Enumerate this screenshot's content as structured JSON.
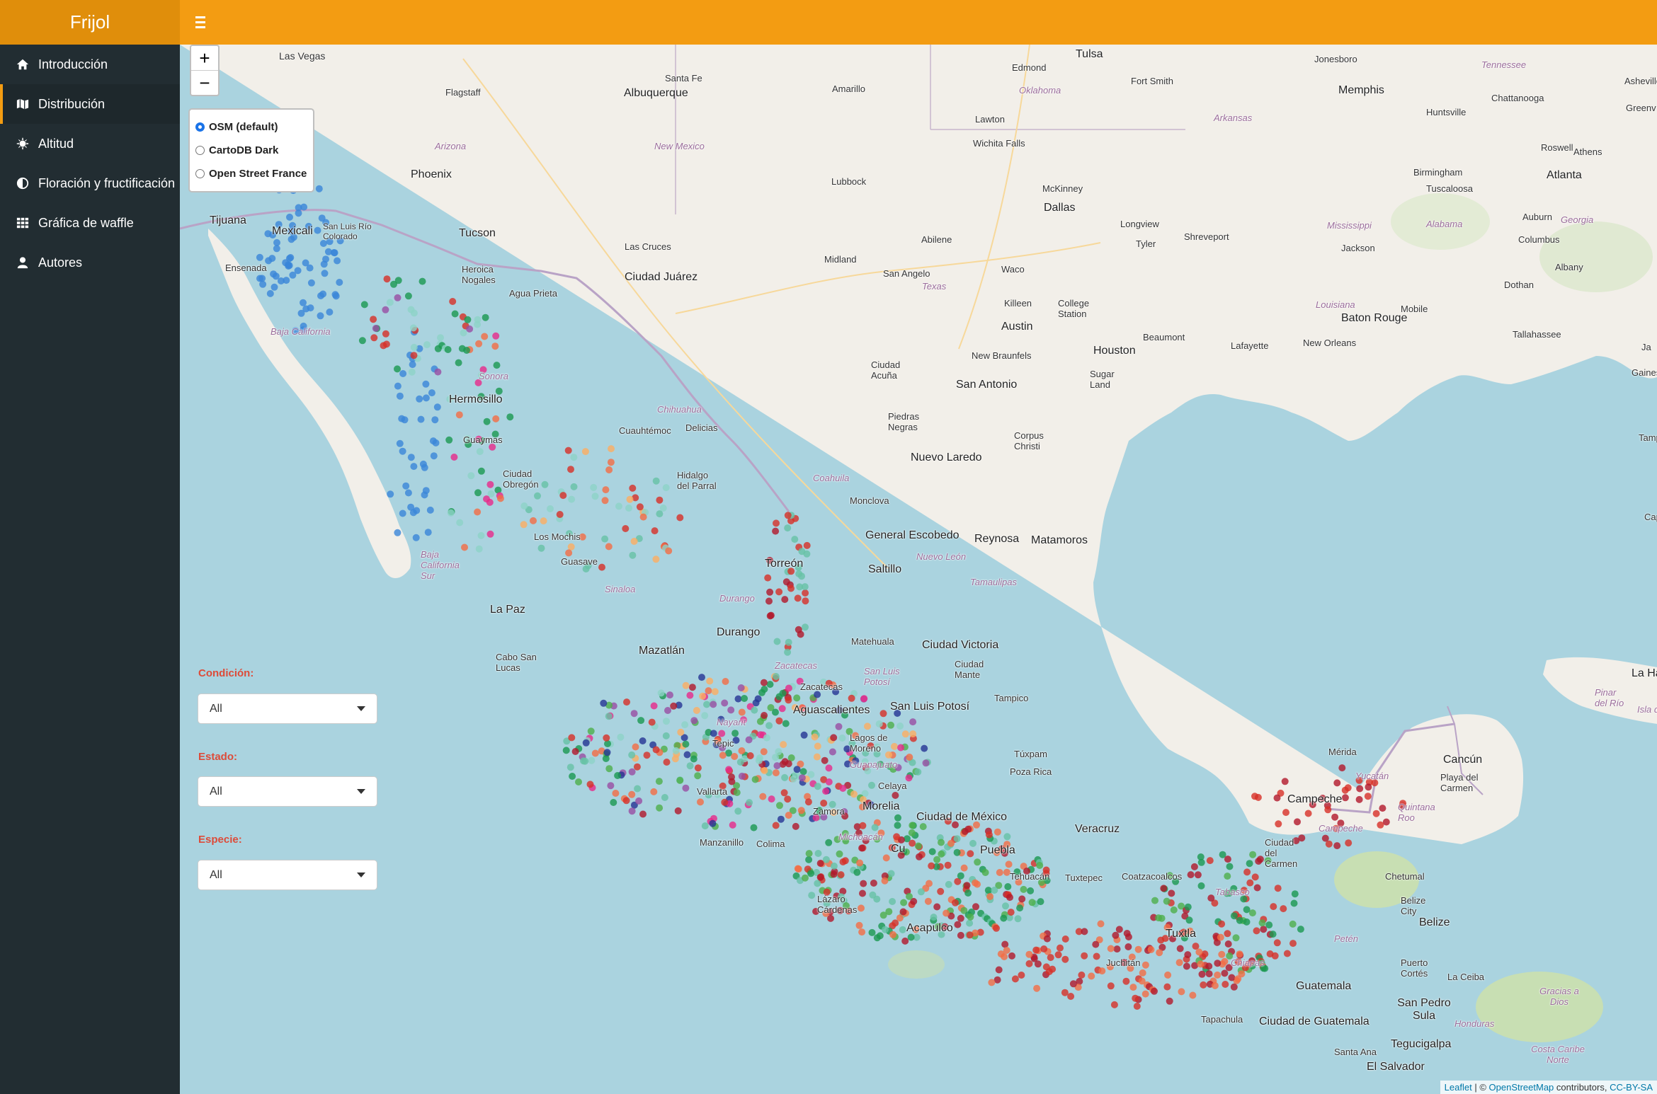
{
  "app": {
    "title": "Frijol"
  },
  "sidebar": {
    "items": [
      {
        "label": "Introducción",
        "icon": "home-icon",
        "active": false
      },
      {
        "label": "Distribución",
        "icon": "map-icon",
        "active": true
      },
      {
        "label": "Altitud",
        "icon": "sun-icon",
        "active": false
      },
      {
        "label": "Floración y fructificación",
        "icon": "adjust-icon",
        "active": false
      },
      {
        "label": "Gráfica de waffle",
        "icon": "grid-icon",
        "active": false
      },
      {
        "label": "Autores",
        "icon": "user-icon",
        "active": false
      }
    ]
  },
  "map": {
    "zoom_in": "+",
    "zoom_out": "−",
    "layers": [
      {
        "label": "OSM (default)",
        "selected": true
      },
      {
        "label": "CartoDB Dark",
        "selected": false
      },
      {
        "label": "Open Street France",
        "selected": false
      }
    ],
    "filters": [
      {
        "label": "Condición:",
        "value": "All"
      },
      {
        "label": "Estado:",
        "value": "All"
      },
      {
        "label": "Especie:",
        "value": "All"
      }
    ],
    "attribution": {
      "leaflet": "Leaflet",
      "sep": " | © ",
      "osm": "OpenStreetMap",
      "contrib": " contributors, ",
      "license": "CC-BY-SA"
    },
    "places": {
      "las_vegas": "Las Vegas",
      "flagstaff": "Flagstaff",
      "albuquerque": "Albuquerque",
      "santa_fe": "Santa Fe",
      "amarillo": "Amarillo",
      "edmond": "Edmond",
      "oklahoma": "Oklahoma",
      "tulsa": "Tulsa",
      "fort_smith": "Fort Smith",
      "memphis": "Memphis",
      "jonesboro": "Jonesboro",
      "tennessee": "Tennessee",
      "chattanooga": "Chattanooga",
      "huntsville": "Huntsville",
      "roswell": "Roswell",
      "athens": "Athens",
      "atlanta": "Atlanta",
      "birmingham": "Birmingham",
      "arkansas": "Arkansas",
      "arizona": "Arizona",
      "new_mexico": "New Mexico",
      "phoenix": "Phoenix",
      "lawton": "Lawton",
      "wichita_falls": "Wichita Falls",
      "lubbock": "Lubbock",
      "mckinney": "McKinney",
      "dallas": "Dallas",
      "tuscaloosa": "Tuscaloosa",
      "mississippi": "Mississippi",
      "alabama": "Alabama",
      "georgia": "Georgia",
      "auburn": "Auburn",
      "columbus": "Columbus",
      "tijuana": "Tijuana",
      "mexicali": "Mexicali",
      "san_luis_rc": "San Luis Río Colorado",
      "tucson": "Tucson",
      "las_cruces": "Las Cruces",
      "abilene": "Abilene",
      "longview": "Longview",
      "tyler": "Tyler",
      "shreveport": "Shreveport",
      "jackson": "Jackson",
      "albany": "Albany",
      "dothan": "Dothan",
      "ensenada": "Ensenada",
      "heroica_nogales": "Heroica Nogales",
      "ciudad_juarez": "Ciudad Juárez",
      "midland": "Midland",
      "san_angelo": "San Angelo",
      "texas": "Texas",
      "waco": "Waco",
      "agua_prieta": "Agua Prieta",
      "killeen": "Killeen",
      "college_station": "College Station",
      "baton_rouge": "Baton Rouge",
      "mobile": "Mobile",
      "tallahassee": "Tallahassee",
      "baja_california": "Baja California",
      "austin": "Austin",
      "beaumont": "Beaumont",
      "lafayette": "Lafayette",
      "new_orleans": "New Orleans",
      "louisiana": "Louisiana",
      "houston": "Houston",
      "sugar_land": "Sugar Land",
      "new_braunfels": "New Braunfels",
      "sonora": "Sonora",
      "hermosillo": "Hermosillo",
      "ciudad_acuna": "Ciudad Acuña",
      "san_antonio": "San Antonio",
      "chihuahua": "Chihuahua",
      "delicias": "Delicias",
      "cuauhtemoc": "Cuauhtémoc",
      "guaymas": "Guaymas",
      "piedras_negras": "Piedras Negras",
      "corpus_christi": "Corpus Christi",
      "nuevo_laredo": "Nuevo Laredo",
      "ciudad_obregon": "Ciudad Obregón",
      "hidalgo_parral": "Hidalgo del Parral",
      "coahuila": "Coahuila",
      "monclova": "Monclova",
      "general_escobedo": "General Escobedo",
      "reynosa": "Reynosa",
      "matamoros": "Matamoros",
      "los_mochis": "Los Mochis",
      "nuevo_leon": "Nuevo León",
      "baja_california_sur": "Baja California Sur",
      "guasave": "Guasave",
      "torreon": "Torreón",
      "saltillo": "Saltillo",
      "tamaulipas": "Tamaulipas",
      "sinaloa": "Sinaloa",
      "durango_state": "Durango",
      "durango": "Durango",
      "la_paz": "La Paz",
      "matehuala": "Matehuala",
      "ciudad_victoria": "Ciudad Victoria",
      "cabo_san_lucas": "Cabo San Lucas",
      "mazatlan": "Mazatlán",
      "zacatecas_state": "Zacatecas",
      "ciudad_mante": "Ciudad Mante",
      "slp_state": "San Luis Potosí",
      "zacatecas": "Zacatecas",
      "san_luis_potosi": "San Luis Potosí",
      "tampico": "Tampico",
      "aguascalientes": "Aguascalientes",
      "nayarit": "Nayarit",
      "tepic": "Tepic",
      "lagos_de_moreno": "Lagos de Moreno",
      "guanajuato": "Guanajuato",
      "tuxpam": "Túxpam",
      "poza_rica": "Poza Rica",
      "merida": "Mérida",
      "cancun": "Cancún",
      "yucatan": "Yucatán",
      "playa_del_carmen": "Playa del Carmen",
      "celaya": "Celaya",
      "puerto_vallarta": "Vallarta",
      "ciudad_de_mexico": "Ciudad de México",
      "campeche": "Campeche",
      "campeche_state": "Campeche",
      "quintana_roo": "Quintana Roo",
      "morelia": "Morelia",
      "michoacan": "Michoacán",
      "zamora": "Zamora",
      "coatzacoalcos": "Coatzacoalcos",
      "manzanillo": "Manzanillo",
      "colima": "Colima",
      "cuernavaca": "Cu",
      "puebla": "Puebla",
      "veracruz": "Veracruz",
      "ciudad_del_carmen": "Ciudad del Carmen",
      "tehuacan": "Tehuacán",
      "tuxtepec": "Tuxtepec",
      "tabasco": "Tabasco",
      "chetumal": "Chetumal",
      "lazaro_cardenas": "Lázaro Cárdenas",
      "belize_city": "Belize City",
      "acapulco": "Acapulco",
      "belize": "Belize",
      "tuxtla": "Tuxtla",
      "chiapas": "Chiapas",
      "peten": "Petén",
      "juchitan": "Juchitán",
      "puerto_cortes": "Puerto Cortés",
      "la_ceiba": "La Ceiba",
      "guatemala": "Guatemala",
      "san_pedro_sula": "San Pedro Sula",
      "tapachula": "Tapachula",
      "ciudad_de_guatemala": "Ciudad de Guatemala",
      "honduras": "Honduras",
      "santa_ana": "Santa Ana",
      "tegucigalpa": "Tegucigalpa",
      "el_salvador": "El Salvador",
      "gracias_a_dios": "Gracias a Dios",
      "costa_caribe": "Costa Caribe Norte",
      "la_habana": "La Hab",
      "pinar_del_rio": "Pinar del Río",
      "isla_de": "Isla de",
      "asheville": "Asheville",
      "greenv": "Greenv",
      "jacks": "Ja",
      "gainesv": "Gainesv",
      "tampa": "Tampa",
      "cape": "Cap"
    }
  }
}
